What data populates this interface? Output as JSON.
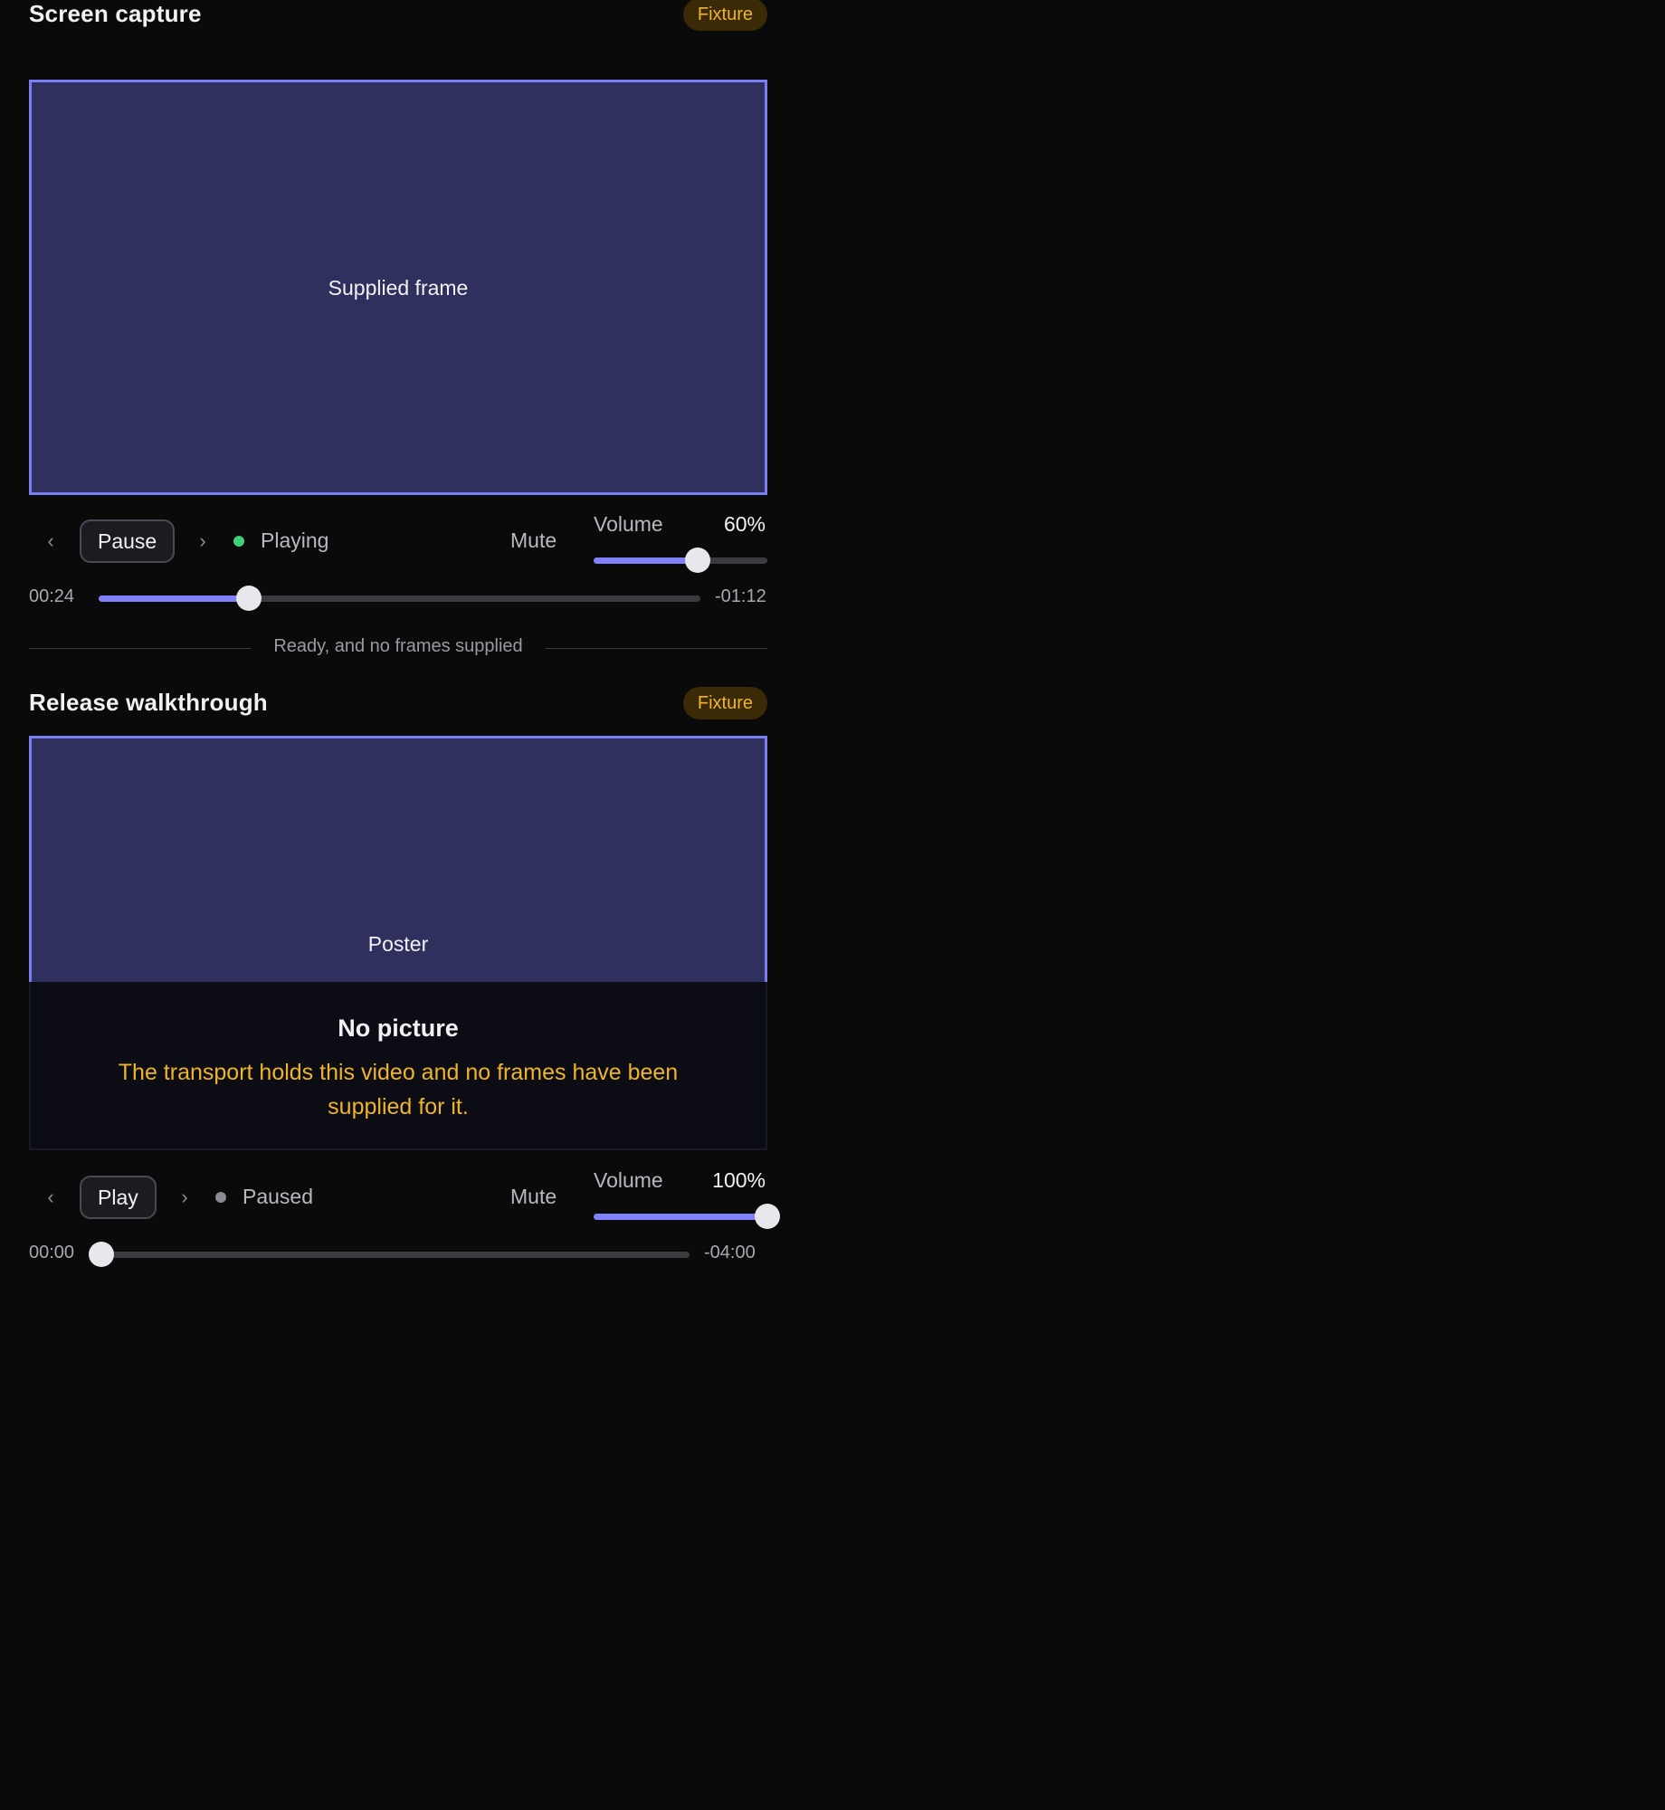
{
  "players": [
    {
      "title": "Screen capture",
      "badge": "Fixture",
      "frame_label": "Supplied frame",
      "prev_icon": "chevron-left-icon",
      "next_icon": "chevron-right-icon",
      "action_label": "Pause",
      "status": "Playing",
      "status_color": "#3ecf7a",
      "mute_label": "Mute",
      "volume_label": "Volume",
      "volume_value": "60%",
      "volume_fraction": 0.6,
      "elapsed": "00:24",
      "remaining": "-01:12",
      "progress_fraction": 0.25
    },
    {
      "title": "Release walkthrough",
      "badge": "Fixture",
      "frame_label": "Poster",
      "no_picture_title": "No picture",
      "no_picture_message": "The transport holds this video and no frames have been supplied for it.",
      "prev_icon": "chevron-left-icon",
      "next_icon": "chevron-right-icon",
      "action_label": "Play",
      "status": "Paused",
      "status_color": "#8a8a92",
      "mute_label": "Mute",
      "volume_label": "Volume",
      "volume_value": "100%",
      "volume_fraction": 1.0,
      "elapsed": "00:00",
      "remaining": "-04:00",
      "progress_fraction": 0.0
    }
  ],
  "divider_text": "Ready, and no frames supplied",
  "accent_color": "#8080f8",
  "badge_color": "#f0b429"
}
